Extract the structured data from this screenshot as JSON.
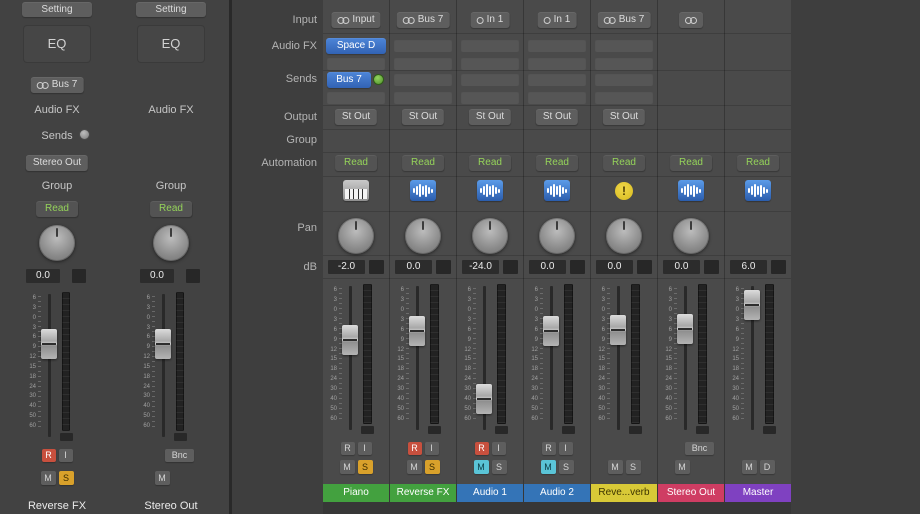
{
  "colors": {
    "track_green": "#43a13f",
    "track_blue": "#3474b7",
    "track_yellow": "#d8c937",
    "track_red": "#cf3d63",
    "track_purple": "#7f41c1",
    "automation_green": "#95d35a",
    "slot_blue": "#3e6fc0",
    "record_red": "#c8503e",
    "solo_orange": "#d9a12b",
    "mute_teal": "#5ac4d7"
  },
  "icons": {
    "warning_glyph": "!"
  },
  "inspector": {
    "strips": [
      {
        "setting": "Setting",
        "eq": "EQ",
        "input": {
          "format": "stereo",
          "label": "Bus 7"
        },
        "audio_fx_label": "Audio FX",
        "sends_label": "Sends",
        "output": "Stereo Out",
        "group": "Group",
        "automation": "Read",
        "db": "0.0",
        "fader": 0.32,
        "row1": [
          {
            "label": "R",
            "state": "record"
          },
          {
            "label": "I",
            "state": "off"
          }
        ],
        "row2": [
          {
            "label": "M",
            "state": "off"
          },
          {
            "label": "S",
            "state": "solo"
          }
        ],
        "name": "Reverse FX"
      },
      {
        "setting": "Setting",
        "eq": "EQ",
        "audio_fx_label": "Audio FX",
        "group": "Group",
        "automation": "Read",
        "db": "0.0",
        "fader": 0.32,
        "row1": [
          {
            "spacer": true
          },
          {
            "label": "Bnc",
            "state": "off",
            "wide": true
          }
        ],
        "row2": [
          {
            "label": "M",
            "state": "off"
          },
          {
            "spacer": true
          }
        ],
        "name": "Stereo Out"
      }
    ]
  },
  "mixer": {
    "row_labels": [
      "Input",
      "Audio FX",
      "Sends",
      "Output",
      "Group",
      "Automation",
      "Pan",
      "dB"
    ],
    "fader_scale": [
      "6",
      "3",
      "0",
      "3",
      "6",
      "9",
      "12",
      "15",
      "18",
      "24",
      "30",
      "40",
      "50",
      "60"
    ],
    "strips": [
      {
        "name": "Piano",
        "color": "#43a13f",
        "name_text": "#ffffff",
        "input": {
          "format": "stereo",
          "label": "Input"
        },
        "fx": [
          "Space D",
          ""
        ],
        "sends": [
          "Bus 7",
          ""
        ],
        "output": "St Out",
        "automation": "Read",
        "icon": "piano",
        "has_pan": true,
        "db": "-2.0",
        "fader": 0.35,
        "row1": [
          {
            "label": "R",
            "state": "off"
          },
          {
            "label": "I",
            "state": "off"
          }
        ],
        "row2": [
          {
            "label": "M",
            "state": "off"
          },
          {
            "label": "S",
            "state": "solo"
          }
        ]
      },
      {
        "name": "Reverse FX",
        "color": "#43a13f",
        "name_text": "#ffffff",
        "input": {
          "format": "stereo",
          "label": "Bus 7"
        },
        "fx": [
          "",
          ""
        ],
        "sends": [
          "",
          ""
        ],
        "output": "St Out",
        "automation": "Read",
        "icon": "waveform",
        "has_pan": true,
        "db": "0.0",
        "fader": 0.27,
        "row1": [
          {
            "label": "R",
            "state": "record"
          },
          {
            "label": "I",
            "state": "off"
          }
        ],
        "row2": [
          {
            "label": "M",
            "state": "off"
          },
          {
            "label": "S",
            "state": "solo"
          }
        ]
      },
      {
        "name": "Audio 1",
        "color": "#3474b7",
        "name_text": "#ffffff",
        "input": {
          "format": "mono",
          "label": "In 1"
        },
        "fx": [
          "",
          ""
        ],
        "sends": [
          "",
          ""
        ],
        "output": "St Out",
        "automation": "Read",
        "icon": "waveform",
        "has_pan": true,
        "db": "-24.0",
        "fader": 0.85,
        "row1": [
          {
            "label": "R",
            "state": "record"
          },
          {
            "label": "I",
            "state": "off"
          }
        ],
        "row2": [
          {
            "label": "M",
            "state": "mute"
          },
          {
            "label": "S",
            "state": "off"
          }
        ]
      },
      {
        "name": "Audio 2",
        "color": "#3474b7",
        "name_text": "#ffffff",
        "input": {
          "format": "mono",
          "label": "In 1"
        },
        "fx": [
          "",
          ""
        ],
        "sends": [
          "",
          ""
        ],
        "output": "St Out",
        "automation": "Read",
        "icon": "waveform",
        "has_pan": true,
        "db": "0.0",
        "fader": 0.27,
        "row1": [
          {
            "label": "R",
            "state": "off"
          },
          {
            "label": "I",
            "state": "off"
          }
        ],
        "row2": [
          {
            "label": "M",
            "state": "mute"
          },
          {
            "label": "S",
            "state": "off"
          }
        ]
      },
      {
        "name": "Reve...verb",
        "color": "#d8c937",
        "name_text": "#3c3400",
        "input": {
          "format": "stereo",
          "label": "Bus 7"
        },
        "fx": [
          "",
          ""
        ],
        "sends": [
          "",
          ""
        ],
        "output": "St Out",
        "automation": "Read",
        "icon": "warning",
        "has_pan": true,
        "db": "0.0",
        "fader": 0.26,
        "row2": [
          {
            "label": "M",
            "state": "off"
          },
          {
            "label": "S",
            "state": "off"
          }
        ]
      },
      {
        "name": "Stereo Out",
        "color": "#cf3d63",
        "name_text": "#ffffff",
        "input": {
          "format": "stereo",
          "label": ""
        },
        "automation": "Read",
        "icon": "waveform",
        "has_pan": true,
        "db": "0.0",
        "fader": 0.25,
        "row1": [
          {
            "spacer": true
          },
          {
            "label": "Bnc",
            "state": "off",
            "wide": true
          }
        ],
        "row2": [
          {
            "label": "M",
            "state": "off"
          },
          {
            "spacer": true
          }
        ]
      },
      {
        "name": "Master",
        "color": "#7f41c1",
        "name_text": "#ffffff",
        "automation": "Read",
        "icon": "waveform",
        "has_pan": false,
        "db": "6.0",
        "fader": 0.05,
        "row2": [
          {
            "label": "M",
            "state": "off"
          },
          {
            "label": "D",
            "state": "off"
          }
        ]
      }
    ]
  }
}
